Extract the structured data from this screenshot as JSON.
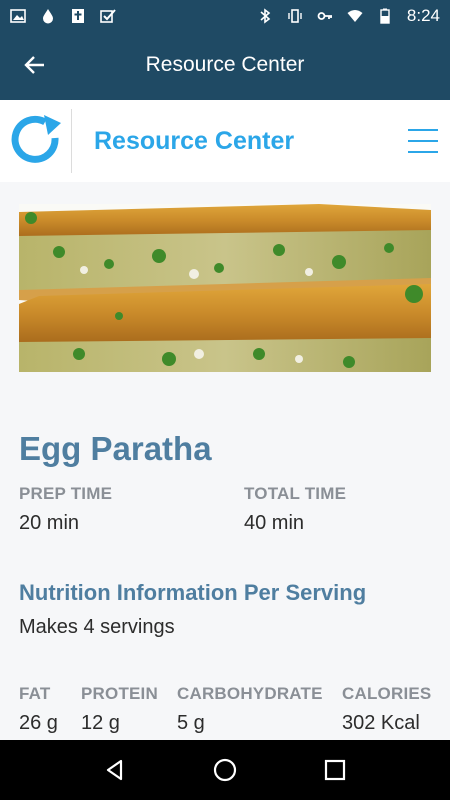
{
  "status_bar": {
    "time": "8:24",
    "left_icons": [
      "image-icon",
      "drop-icon",
      "bible-icon",
      "checkbox-icon"
    ],
    "right_icons": [
      "bluetooth-icon",
      "vibrate-icon",
      "key-icon",
      "wifi-icon",
      "battery-icon"
    ]
  },
  "app_bar": {
    "title": "Resource Center"
  },
  "site_header": {
    "title": "Resource Center"
  },
  "recipe": {
    "title": "Egg Paratha",
    "prep_time_label": "PREP TIME",
    "prep_time": "20 min",
    "total_time_label": "TOTAL TIME",
    "total_time": "40 min",
    "nutrition_heading": "Nutrition Information Per Serving",
    "servings": "Makes 4 servings",
    "nutrition": [
      {
        "label": "FAT",
        "value": "26 g"
      },
      {
        "label": "PROTEIN",
        "value": "12 g"
      },
      {
        "label": "CARBOHYDRATE",
        "value": "5 g"
      },
      {
        "label": "CALORIES",
        "value": "302 Kcal"
      }
    ]
  },
  "colors": {
    "app_bar": "#1f4a64",
    "accent": "#2ba6e8",
    "heading": "#4f7ea0"
  }
}
